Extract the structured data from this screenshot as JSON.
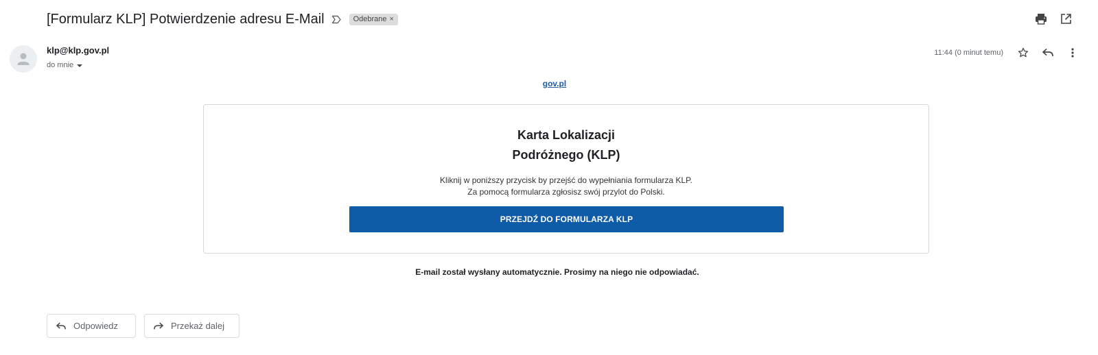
{
  "email": {
    "subject": "[Formularz KLP] Potwierdzenie adresu E-Mail",
    "label": "Odebrane",
    "label_remove": "×",
    "sender": "klp@klp.gov.pl",
    "recipient": "do mnie",
    "time": "11:44 (0 minut temu)"
  },
  "body": {
    "gov_link": "gov.pl",
    "card_title_line1": "Karta Lokalizacji",
    "card_title_line2": "Podróżnego (KLP)",
    "card_text_line1": "Kliknij w poniższy przycisk by przejść do wypełniania formularza KLP.",
    "card_text_line2": "Za pomocą formularza zgłosisz swój przylot do Polski.",
    "cta_label": "PRZEJDŹ DO FORMULARZA KLP",
    "auto_note": "E-mail został wysłany automatycznie. Prosimy na niego nie odpowiadać."
  },
  "actions": {
    "reply": "Odpowiedz",
    "forward": "Przekaż dalej"
  },
  "icons": {
    "importance": "importance-marker-icon",
    "print": "print-icon",
    "open_new_window": "open-in-new-window-icon",
    "avatar": "person-icon",
    "star": "star-icon",
    "reply": "reply-icon",
    "more": "more-vert-icon",
    "forward": "forward-icon"
  },
  "colors": {
    "cta": "#0e5ba7",
    "link": "#2159a5",
    "chip": "#dddddd"
  }
}
